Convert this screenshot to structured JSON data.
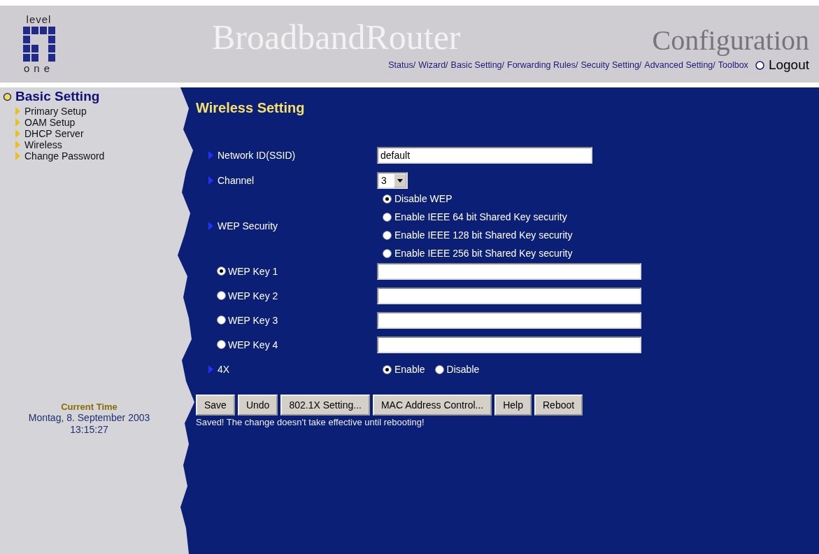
{
  "header": {
    "logo_top": "level",
    "logo_bottom": "one",
    "title": "BroadbandRouter",
    "subtitle": "Configuration",
    "nav": [
      {
        "label": "Status/"
      },
      {
        "label": "Wizard/"
      },
      {
        "label": "Basic Setting/"
      },
      {
        "label": "Forwarding Rules/"
      },
      {
        "label": "Secuity Setting/"
      },
      {
        "label": "Advanced Setting/"
      },
      {
        "label": "Toolbox"
      }
    ],
    "logout": "Logout"
  },
  "sidebar": {
    "section": "Basic Setting",
    "items": [
      {
        "label": "Primary Setup"
      },
      {
        "label": "OAM Setup"
      },
      {
        "label": "DHCP Server"
      },
      {
        "label": "Wireless"
      },
      {
        "label": "Change Password"
      }
    ],
    "time_label": "Current Time",
    "date": "Montag, 8. September 2003",
    "time": "13:15:27"
  },
  "main": {
    "title": "Wireless Setting",
    "rows": [
      {
        "kind": "text",
        "label": "Network ID(SSID)",
        "value": "default"
      },
      {
        "kind": "select",
        "label": "Channel",
        "value": "3"
      },
      {
        "kind": "radios",
        "label": "WEP Security",
        "options": [
          {
            "label": "Disable WEP",
            "selected": true
          },
          {
            "label": "Enable IEEE 64 bit Shared Key security",
            "selected": false
          },
          {
            "label": "Enable IEEE 128 bit Shared Key security",
            "selected": false
          },
          {
            "label": "Enable IEEE 256 bit Shared Key security",
            "selected": false
          }
        ]
      }
    ],
    "keys": [
      {
        "label": "WEP Key 1",
        "selected": true
      },
      {
        "label": "WEP Key 2",
        "selected": false
      },
      {
        "label": "WEP Key 3",
        "selected": false
      },
      {
        "label": "WEP Key 4",
        "selected": false
      }
    ],
    "fourx": {
      "label": "4X",
      "options": [
        {
          "label": "Enable",
          "selected": true
        },
        {
          "label": "Disable",
          "selected": false
        }
      ]
    },
    "buttons": [
      {
        "label": "Save"
      },
      {
        "label": "Undo"
      },
      {
        "label": "802.1X Setting..."
      },
      {
        "label": "MAC Address Control..."
      },
      {
        "label": "Help"
      },
      {
        "label": "Reboot"
      }
    ],
    "message": "Saved! The change doesn't take effective until rebooting!"
  }
}
